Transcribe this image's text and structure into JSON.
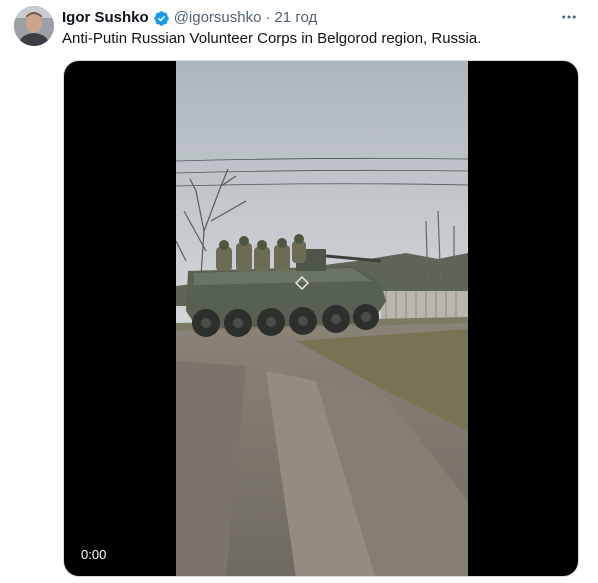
{
  "author": {
    "name": "Igor Sushko",
    "handle": "@igorsushko",
    "separator": "·",
    "time": "21 год"
  },
  "tweet": {
    "text": "Anti-Putin Russian Volunteer Corps in Belgorod region, Russia."
  },
  "media": {
    "type": "video",
    "timestamp": "0:00"
  },
  "icons": {
    "verified": "verified-badge-icon",
    "more": "more-options-icon"
  },
  "colors": {
    "verified_blue": "#1d9bf0",
    "secondary_text": "#536471",
    "primary_text": "#0f1419"
  }
}
